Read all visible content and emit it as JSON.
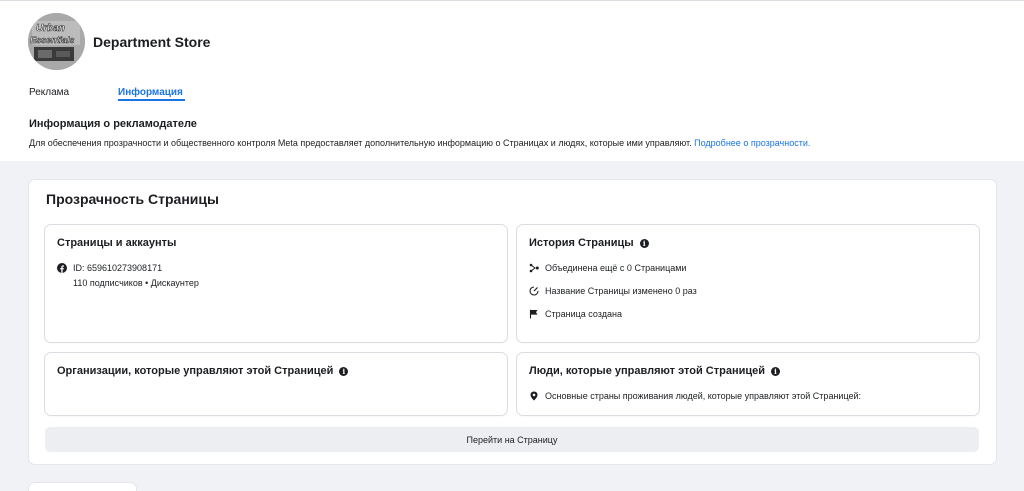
{
  "header": {
    "page_name": "Department Store",
    "avatar_logo_text": "Urban Essentials"
  },
  "tabs": [
    {
      "label": "Реклама",
      "active": false
    },
    {
      "label": "Информация",
      "active": true
    }
  ],
  "advertiser": {
    "title": "Информация о рекламодателе",
    "description": "Для обеспечения прозрачности и общественного контроля Meta предоставляет дополнительную информацию о Страницах и людях, которые ими управляют.",
    "link": "Подробнее о прозрачности."
  },
  "transparency": {
    "title": "Прозрачность Страницы",
    "pages_accounts": {
      "title": "Страницы и аккаунты",
      "icon": "facebook-icon",
      "id_line": "ID: 659610273908171",
      "detail": "110 подписчиков • Дискаунтер"
    },
    "history": {
      "title": "История Страницы",
      "items": [
        {
          "icon": "merge-icon",
          "text": "Объединена ещё с 0 Страницами"
        },
        {
          "icon": "rename-icon",
          "text": "Название Страницы изменено 0 раз"
        },
        {
          "icon": "flag-icon",
          "text": "Страница создана"
        }
      ]
    },
    "organizations": {
      "title": "Организации, которые управляют этой Страницей"
    },
    "people": {
      "title": "Люди, которые управляют этой Страницей",
      "icon": "location-pin-icon",
      "text": "Основные страны проживания людей, которые управляют этой Страницей:"
    },
    "button_label": "Перейти на Страницу"
  },
  "colors": {
    "accent": "#1b74e4",
    "background": "#f0f2f5",
    "button_bg": "#eceef1"
  }
}
